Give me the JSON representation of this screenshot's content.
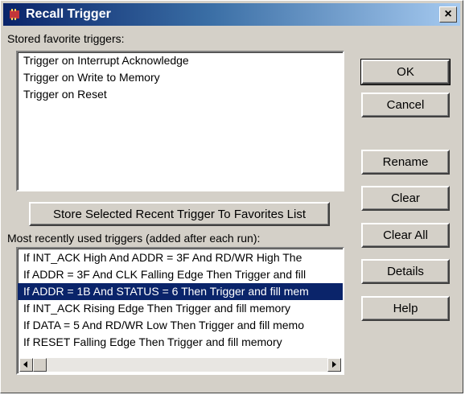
{
  "window": {
    "title": "Recall Trigger",
    "close_glyph": "×"
  },
  "favorites": {
    "label": "Stored favorite triggers:",
    "items": [
      "Trigger on Interrupt Acknowledge",
      "Trigger on Write to Memory",
      "Trigger on Reset"
    ]
  },
  "store_button_label": "Store Selected Recent Trigger To Favorites List",
  "recent": {
    "label": "Most recently used triggers (added after each run):",
    "selected_index": 2,
    "items": [
      "If INT_ACK High And ADDR = 3F And RD/WR High The",
      "If ADDR = 3F And CLK Falling Edge Then Trigger and fill",
      "If ADDR = 1B And STATUS = 6 Then Trigger and fill mem",
      "If INT_ACK Rising Edge Then Trigger and fill memory",
      "If DATA = 5 And RD/WR Low Then Trigger and fill memo",
      "If RESET Falling Edge Then Trigger and fill memory"
    ]
  },
  "buttons": {
    "ok": "OK",
    "cancel": "Cancel",
    "rename": "Rename",
    "clear": "Clear",
    "clear_all": "Clear All",
    "details": "Details",
    "help": "Help"
  },
  "icons": {
    "app": "chip-icon",
    "close": "close-icon",
    "scroll_left": "arrow-left-icon",
    "scroll_right": "arrow-right-icon"
  },
  "colors": {
    "titlebar_start": "#0a246a",
    "titlebar_end": "#a6caf0",
    "selection": "#0a246a",
    "face": "#d4d0c8"
  }
}
